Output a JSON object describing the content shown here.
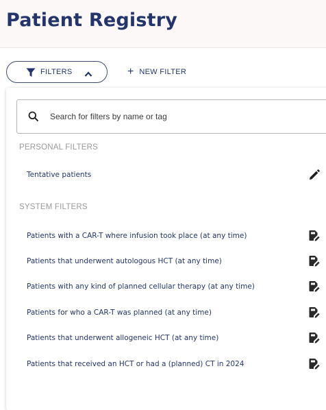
{
  "header": {
    "title": "Patient Registry"
  },
  "toolbar": {
    "filters_label": "FILTERS",
    "new_filter_label": "NEW FILTER",
    "new_filter_plus": "+"
  },
  "search": {
    "placeholder": "Search for filters by name or tag",
    "value": ""
  },
  "personal": {
    "title": "PERSONAL FILTERS",
    "items": [
      {
        "label": "Tentative patients",
        "icon": "pencil-icon"
      }
    ]
  },
  "system": {
    "title": "SYSTEM FILTERS",
    "items": [
      {
        "label": "Patients with a CAR-T where infusion took place (at any time)",
        "icon": "duplicate-edit-icon"
      },
      {
        "label": "Patients that underwent autologous HCT (at any time)",
        "icon": "duplicate-edit-icon"
      },
      {
        "label": "Patients with any kind of planned cellular therapy (at any time)",
        "icon": "duplicate-edit-icon"
      },
      {
        "label": "Patients for who a CAR-T was planned (at any time)",
        "icon": "duplicate-edit-icon"
      },
      {
        "label": "Patients that underwent allogeneic HCT (at any time)",
        "icon": "duplicate-edit-icon"
      },
      {
        "label": "Patients that received an HCT or had a (planned) CT in 2024",
        "icon": "duplicate-edit-icon"
      }
    ]
  },
  "colors": {
    "primary": "#23356b",
    "header_bg": "#fcf8f7",
    "section": "#9a9a9a"
  }
}
